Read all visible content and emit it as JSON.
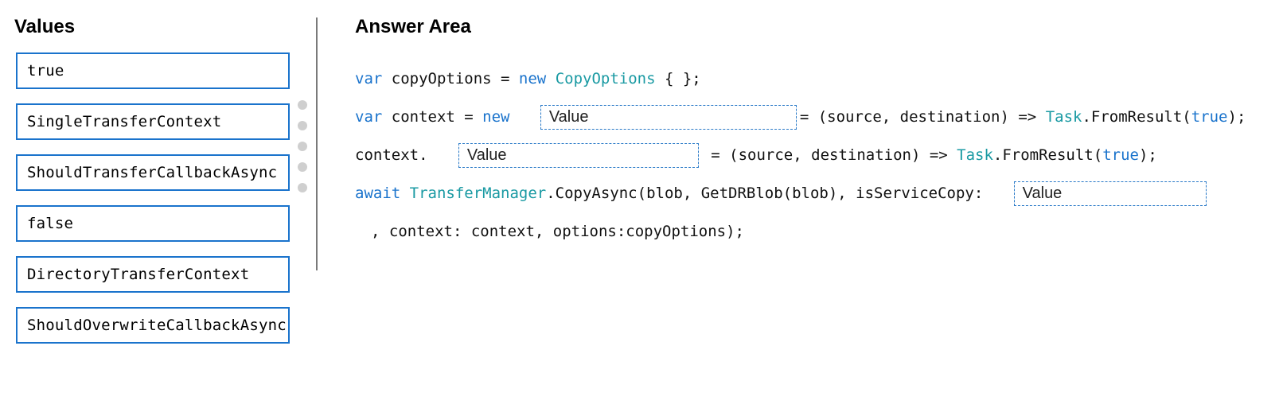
{
  "values_heading": "Values",
  "values": [
    "true",
    "SingleTransferContext",
    "ShouldTransferCallbackAsync",
    "false",
    "DirectoryTransferContext",
    "ShouldOverwriteCallbackAsync"
  ],
  "answer_heading": "Answer Area",
  "placeholder_label": "Value",
  "code": {
    "line1": {
      "pre": "var",
      "mid": " copyOptions = ",
      "new": "new ",
      "type": "CopyOptions",
      "post": " { };"
    },
    "line2": {
      "pre": "var",
      "mid": " context = ",
      "new": "new",
      "eq": "= (source, destination) => ",
      "task": "Task",
      "call": ".FromResult(",
      "tr": "true",
      "end": ");"
    },
    "line3": {
      "pre": "context.",
      "eq": "= (source, destination) => ",
      "task": "Task",
      "call": ".FromResult(",
      "tr": "true",
      "end": ");"
    },
    "line4": {
      "aw": "await ",
      "tm": "TransferManager",
      "call": ".CopyAsync(blob, GetDRBlob(blob), isServiceCopy:"
    },
    "line5": {
      "text": ", context: context, options:copyOptions);"
    }
  }
}
